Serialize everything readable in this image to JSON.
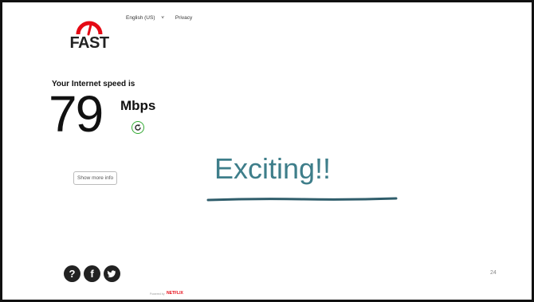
{
  "brand": {
    "logo_text": "FAST"
  },
  "topnav": {
    "language": "English (US)",
    "language_chevron": "˅",
    "privacy": "Privacy"
  },
  "speed": {
    "caption": "Your Internet speed is",
    "value": "79",
    "units": "Mbps"
  },
  "buttons": {
    "show_more_info": "Show more info"
  },
  "headline": "Exciting!!",
  "social": [
    {
      "icon": "help-icon",
      "glyph": "?"
    },
    {
      "icon": "facebook-icon",
      "glyph": "f"
    },
    {
      "icon": "twitter-icon",
      "glyph": ""
    }
  ],
  "footer": {
    "powered_by": "Powered by",
    "brand": "NETFLIX"
  },
  "page_number": "24",
  "colors": {
    "accent_red": "#e50914",
    "headline_teal": "#3e7e8a",
    "underline": "#2f5d6b",
    "refresh_green": "#33aa33"
  }
}
